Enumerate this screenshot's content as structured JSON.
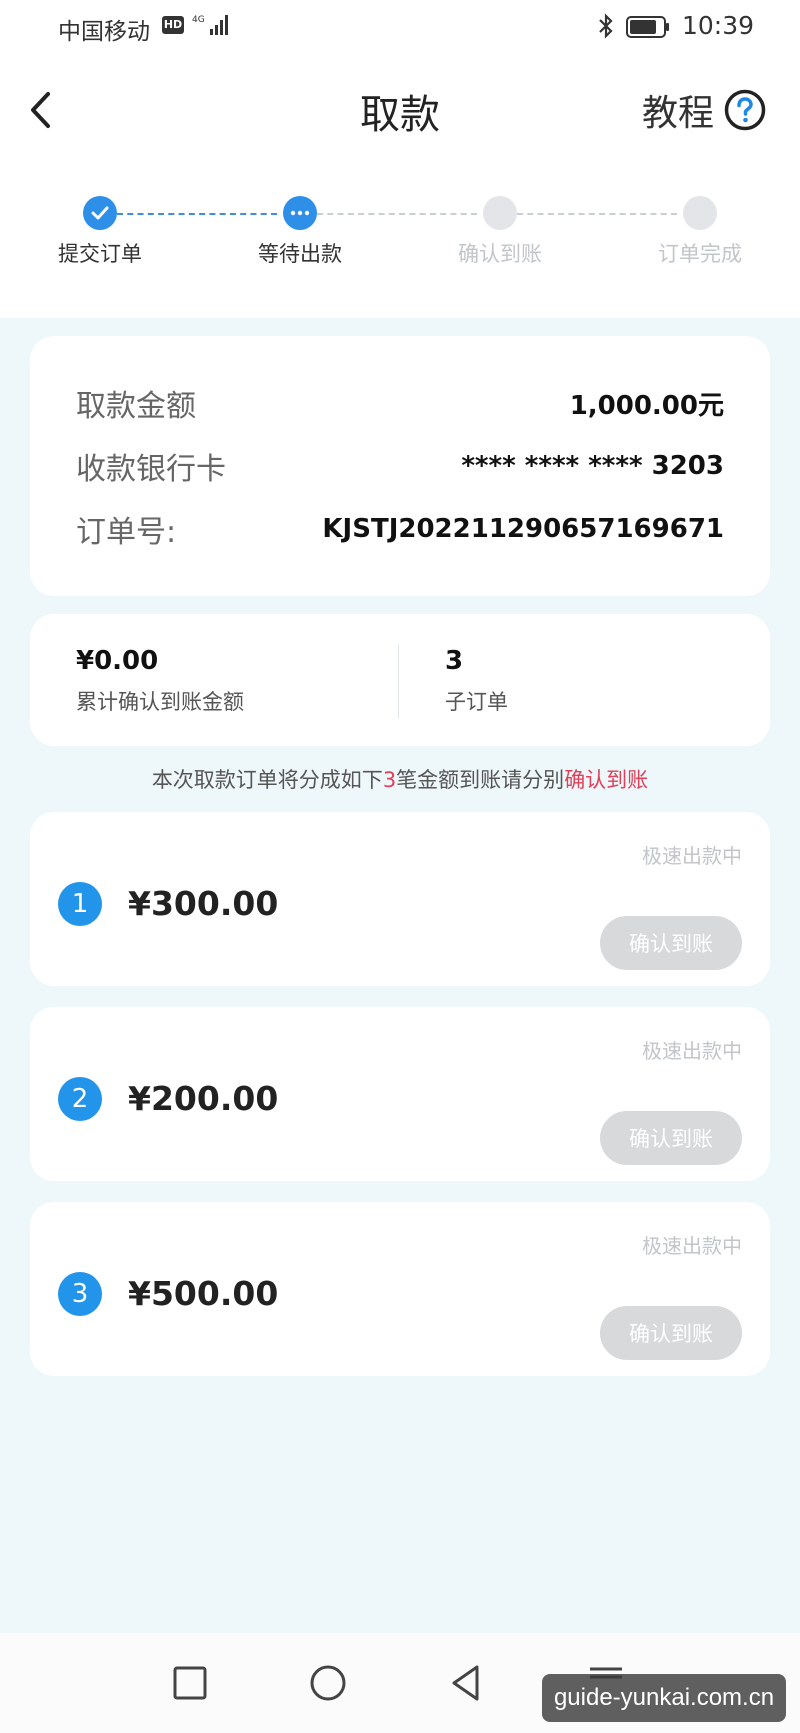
{
  "status_bar": {
    "carrier": "中国移动",
    "hd": "HD",
    "network": "4G",
    "time": "10:39"
  },
  "header": {
    "title": "取款",
    "tutorial_label": "教程"
  },
  "steps": [
    {
      "label": "提交订单",
      "state": "done"
    },
    {
      "label": "等待出款",
      "state": "current"
    },
    {
      "label": "确认到账",
      "state": "pending"
    },
    {
      "label": "订单完成",
      "state": "pending"
    }
  ],
  "info": {
    "amount_label": "取款金额",
    "amount_value": "1,000.00元",
    "card_label": "收款银行卡",
    "card_value": "**** **** **** 3203",
    "order_label": "订单号:",
    "order_value": "KJSTJ20221129065716967​1"
  },
  "summary": {
    "confirmed_amount": "¥0.00",
    "confirmed_label": "累计确认到账金额",
    "sub_order_count": "3",
    "sub_order_label": "子订单"
  },
  "notice": {
    "prefix": "本次取款订单将分成如下",
    "count": "3",
    "middle": "笔金额到账请分别",
    "highlight": "确认到账"
  },
  "orders": [
    {
      "index": "1",
      "amount": "¥300.00",
      "status": "极速出款中",
      "button": "确认到账"
    },
    {
      "index": "2",
      "amount": "¥200.00",
      "status": "极速出款中",
      "button": "确认到账"
    },
    {
      "index": "3",
      "amount": "¥500.00",
      "status": "极速出款中",
      "button": "确认到账"
    }
  ],
  "watermark": "guide-yunkai.com.cn",
  "colors": {
    "accent": "#2d8fe8",
    "highlight": "#e0405a",
    "background": "#eef8fa",
    "disabled_button": "#d7d9db"
  }
}
